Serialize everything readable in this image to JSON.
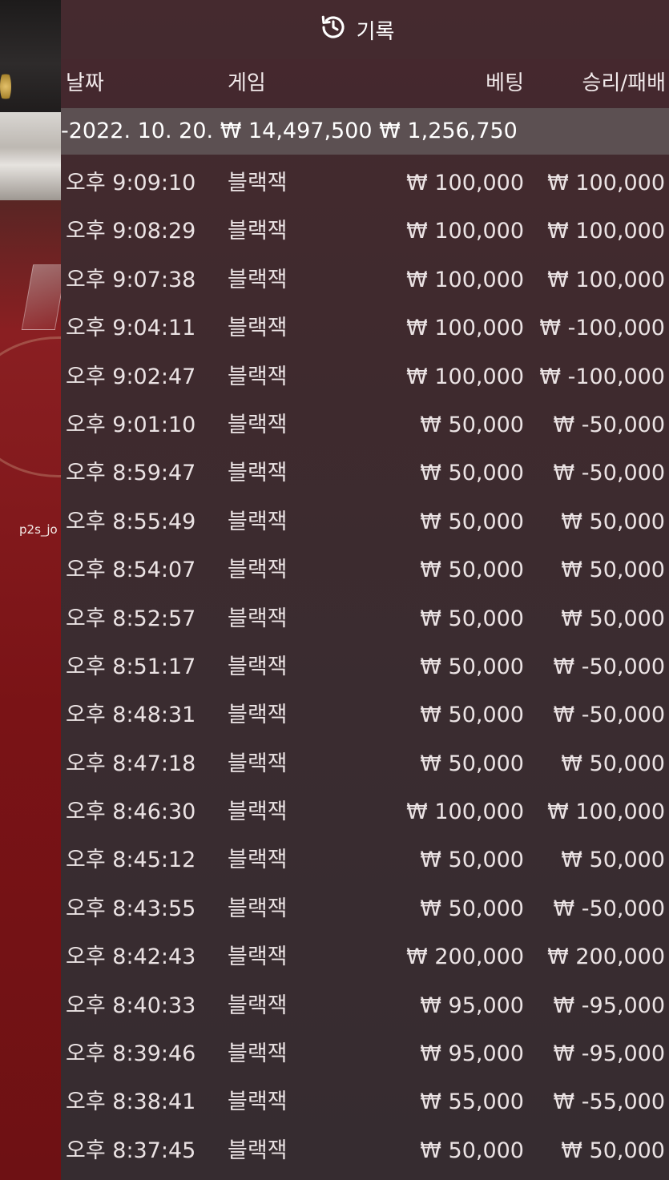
{
  "background": {
    "player_label": "p2s_jo"
  },
  "panel": {
    "title": "기록",
    "icon": "history-icon",
    "columns": {
      "date": "날짜",
      "game": "게임",
      "bet": "베팅",
      "result": "승리/패배"
    },
    "date_group": {
      "date": "-2022. 10. 20.",
      "bet": "₩ 14,497,500",
      "result": "₩ 1,256,750"
    },
    "rows": [
      {
        "time": "오후 9:09:10",
        "game": "블랙잭",
        "bet": "₩ 100,000",
        "result": "₩ 100,000"
      },
      {
        "time": "오후 9:08:29",
        "game": "블랙잭",
        "bet": "₩ 100,000",
        "result": "₩ 100,000"
      },
      {
        "time": "오후 9:07:38",
        "game": "블랙잭",
        "bet": "₩ 100,000",
        "result": "₩ 100,000"
      },
      {
        "time": "오후 9:04:11",
        "game": "블랙잭",
        "bet": "₩ 100,000",
        "result": "₩ -100,000"
      },
      {
        "time": "오후 9:02:47",
        "game": "블랙잭",
        "bet": "₩ 100,000",
        "result": "₩ -100,000"
      },
      {
        "time": "오후 9:01:10",
        "game": "블랙잭",
        "bet": "₩ 50,000",
        "result": "₩ -50,000"
      },
      {
        "time": "오후 8:59:47",
        "game": "블랙잭",
        "bet": "₩ 50,000",
        "result": "₩ -50,000"
      },
      {
        "time": "오후 8:55:49",
        "game": "블랙잭",
        "bet": "₩ 50,000",
        "result": "₩ 50,000"
      },
      {
        "time": "오후 8:54:07",
        "game": "블랙잭",
        "bet": "₩ 50,000",
        "result": "₩ 50,000"
      },
      {
        "time": "오후 8:52:57",
        "game": "블랙잭",
        "bet": "₩ 50,000",
        "result": "₩ 50,000"
      },
      {
        "time": "오후 8:51:17",
        "game": "블랙잭",
        "bet": "₩ 50,000",
        "result": "₩ -50,000"
      },
      {
        "time": "오후 8:48:31",
        "game": "블랙잭",
        "bet": "₩ 50,000",
        "result": "₩ -50,000"
      },
      {
        "time": "오후 8:47:18",
        "game": "블랙잭",
        "bet": "₩ 50,000",
        "result": "₩ 50,000"
      },
      {
        "time": "오후 8:46:30",
        "game": "블랙잭",
        "bet": "₩ 100,000",
        "result": "₩ 100,000"
      },
      {
        "time": "오후 8:45:12",
        "game": "블랙잭",
        "bet": "₩ 50,000",
        "result": "₩ 50,000"
      },
      {
        "time": "오후 8:43:55",
        "game": "블랙잭",
        "bet": "₩ 50,000",
        "result": "₩ -50,000"
      },
      {
        "time": "오후 8:42:43",
        "game": "블랙잭",
        "bet": "₩ 200,000",
        "result": "₩ 200,000"
      },
      {
        "time": "오후 8:40:33",
        "game": "블랙잭",
        "bet": "₩ 95,000",
        "result": "₩ -95,000"
      },
      {
        "time": "오후 8:39:46",
        "game": "블랙잭",
        "bet": "₩ 95,000",
        "result": "₩ -95,000"
      },
      {
        "time": "오후 8:38:41",
        "game": "블랙잭",
        "bet": "₩ 55,000",
        "result": "₩ -55,000"
      },
      {
        "time": "오후 8:37:45",
        "game": "블랙잭",
        "bet": "₩ 50,000",
        "result": "₩ 50,000"
      }
    ]
  }
}
